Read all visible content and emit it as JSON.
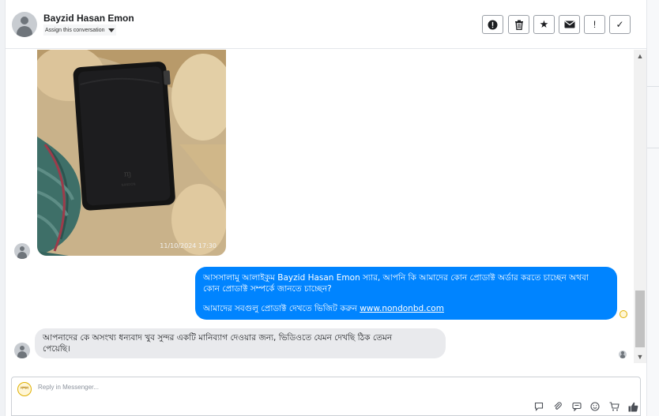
{
  "header": {
    "contact_name": "Bayzid Hasan Emon",
    "assign_label": "Assign this conversation",
    "actions": [
      {
        "name": "spam-button",
        "icon": "alert-circle-icon",
        "glyph": "!"
      },
      {
        "name": "delete-button",
        "icon": "trash-icon",
        "glyph": "🗑"
      },
      {
        "name": "star-button",
        "icon": "star-icon",
        "glyph": "★"
      },
      {
        "name": "mark-unread-button",
        "icon": "envelope-icon",
        "glyph": "✉"
      },
      {
        "name": "important-button",
        "icon": "exclamation-icon",
        "glyph": "!"
      },
      {
        "name": "done-button",
        "icon": "check-icon",
        "glyph": "✓"
      }
    ]
  },
  "thread": {
    "photo_timestamp": "11/10/2024  17:30",
    "outgoing": {
      "line1": "আসসালামু আলাইকুম Bayzid Hasan Emon স্যার,  আপনি কি আমাদের কোন প্রোডাক্ট অর্ডার করতে চাচ্ছেন অথবা",
      "line2": "কোন প্রোডাক্ট সম্পর্কে জানতে চাচ্ছেন?",
      "line3_prefix": "আমাদের সবগুলু প্রোডাক্ট দেখতে  ভিজিট করুন",
      "link": "www.nondonbd.com"
    },
    "incoming": {
      "line1": "আপনাদের কে অসংখ্য ধন্যবাদ খুব সুন্দর একটি মানিব্যাগ দেওয়ার জন্য, ভিডিওতে যেমন দেখছি ঠিক তেমন",
      "line2": "পেয়েছি।"
    }
  },
  "composer": {
    "placeholder": "Reply in Messenger...",
    "logo_text": "নন্দন"
  },
  "colors": {
    "outgoing_bubble": "#0084ff",
    "incoming_bubble": "#e9eaed",
    "divider": "#e4e6eb"
  }
}
